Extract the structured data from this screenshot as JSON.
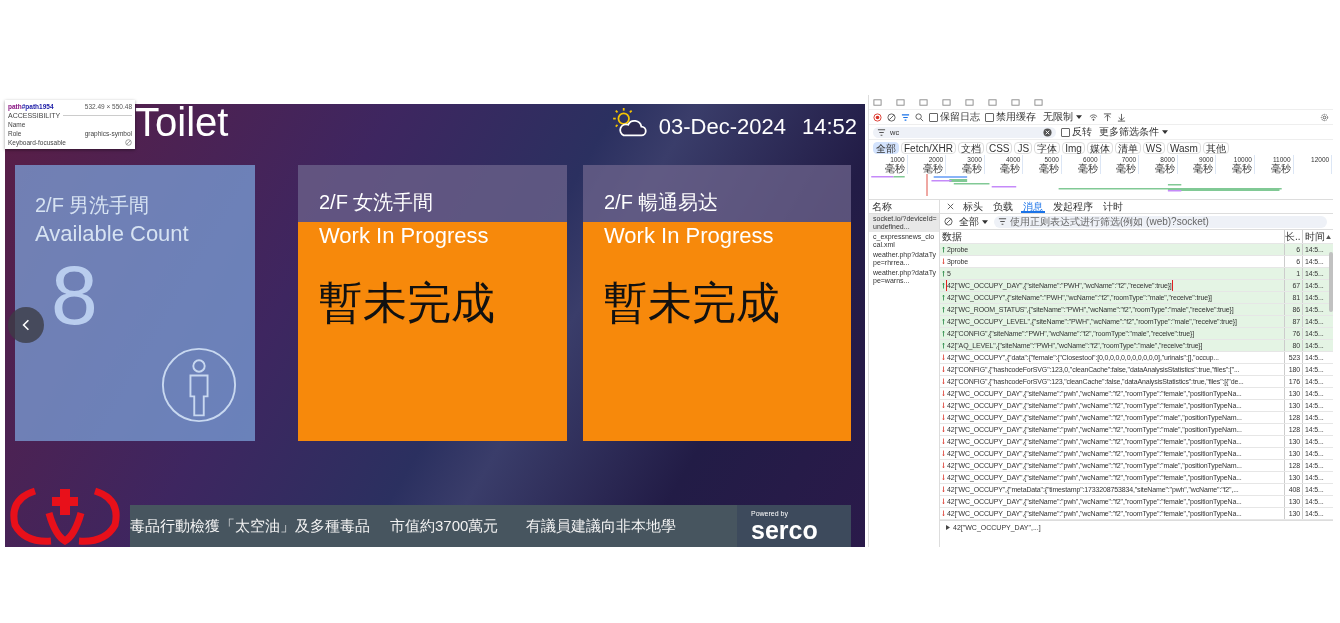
{
  "display": {
    "title": "Toilet",
    "date": "03-Dec-2024",
    "time": "14:52",
    "cards": [
      {
        "kind": "available",
        "title": "2/F 男洗手間",
        "subtitle": "Available Count",
        "value": "8"
      },
      {
        "kind": "wip",
        "title": "2/F 女洗手間",
        "subtitle": "Work In Progress",
        "value": "暫未完成"
      },
      {
        "kind": "wip",
        "title": "2/F 暢通易达",
        "subtitle": "Work In Progress",
        "value": "暫未完成"
      }
    ],
    "ticker": [
      "毒品行動檢獲「太空油」及多種毒品",
      "市值約3700萬元",
      "有議員建議向非本地學"
    ],
    "powered_by": "Powered by",
    "brand": "serco"
  },
  "inspector_tooltip": {
    "tag": "path",
    "id": "#path1954",
    "size": "532.49 × 550.48",
    "section": "ACCESSIBILITY",
    "name_label": "Name",
    "role_label": "Role",
    "role": "graphics-symbol",
    "focusable_label": "Keyboard-focusable",
    "focusable": false
  },
  "devtools": {
    "preserve_log": {
      "label": "保留日志",
      "checked": false
    },
    "disable_cache": {
      "label": "禁用缓存",
      "checked": false
    },
    "throttle": "无限制",
    "filter": {
      "value": "wc",
      "invert": {
        "label": "反转",
        "checked": false
      },
      "more": "更多筛选条件"
    },
    "types": [
      {
        "label": "全部",
        "selected": true
      },
      {
        "label": "Fetch/XHR",
        "selected": false
      },
      {
        "label": "文档",
        "selected": false
      },
      {
        "label": "CSS",
        "selected": false
      },
      {
        "label": "JS",
        "selected": false
      },
      {
        "label": "字体",
        "selected": false
      },
      {
        "label": "Img",
        "selected": false
      },
      {
        "label": "媒体",
        "selected": false
      },
      {
        "label": "清单",
        "selected": false
      },
      {
        "label": "WS",
        "selected": false
      },
      {
        "label": "Wasm",
        "selected": false
      },
      {
        "label": "其他",
        "selected": false
      }
    ],
    "timeline_ticks": [
      {
        "value": "1000",
        "unit": "毫秒"
      },
      {
        "value": "2000",
        "unit": "毫秒"
      },
      {
        "value": "3000",
        "unit": "毫秒"
      },
      {
        "value": "4000",
        "unit": "毫秒"
      },
      {
        "value": "5000",
        "unit": "毫秒"
      },
      {
        "value": "6000",
        "unit": "毫秒"
      },
      {
        "value": "7000",
        "unit": "毫秒"
      },
      {
        "value": "8000",
        "unit": "毫秒"
      },
      {
        "value": "9000",
        "unit": "毫秒"
      },
      {
        "value": "10000",
        "unit": "毫秒"
      },
      {
        "value": "11000",
        "unit": "毫秒"
      },
      {
        "value": "12000"
      }
    ],
    "requests_header": "名称",
    "requests": [
      {
        "name": "socket.io/?deviceId=undefined...",
        "selected": true
      },
      {
        "name": "c_expressnews_clocal.xml",
        "selected": false
      },
      {
        "name": "weather.php?dataType=rhrrea...",
        "selected": false
      },
      {
        "name": "weather.php?dataType=warns...",
        "selected": false
      }
    ],
    "detail_tabs": [
      {
        "label": "标头",
        "selected": false
      },
      {
        "label": "负载",
        "selected": false
      },
      {
        "label": "消息",
        "selected": true
      },
      {
        "label": "发起程序",
        "selected": false
      },
      {
        "label": "计时",
        "selected": false
      }
    ],
    "message_filter": {
      "type": "全部",
      "placeholder": "使用正则表达式进行筛选(例如 (web)?socket)"
    },
    "columns": [
      "数据",
      "长..",
      "时间"
    ],
    "messages": [
      {
        "kind": "sent",
        "data": "2probe",
        "length": "6",
        "time": "14:5...",
        "highlighted": false
      },
      {
        "kind": "received",
        "data": "3probe",
        "length": "6",
        "time": "14:5...",
        "highlighted": false
      },
      {
        "kind": "sent",
        "data": "5",
        "length": "1",
        "time": "14:5...",
        "highlighted": false
      },
      {
        "kind": "sent",
        "data": "42[\"WC_OCCUPY_DAY\",{\"siteName\":\"PWH\",\"wcName\":\"f2\",\"receive\":true}]",
        "length": "67",
        "time": "14:5...",
        "highlighted": true
      },
      {
        "kind": "sent",
        "data": "42[\"WC_OCCUPY\",{\"siteName\":\"PWH\",\"wcName\":\"f2\",\"roomType\":\"male\",\"receive\":true}]",
        "length": "81",
        "time": "14:5...",
        "highlighted": false
      },
      {
        "kind": "sent",
        "data": "42[\"WC_ROOM_STATUS\",{\"siteName\":\"PWH\",\"wcName\":\"f2\",\"roomType\":\"male\",\"receive\":true}]",
        "length": "86",
        "time": "14:5...",
        "highlighted": false
      },
      {
        "kind": "sent",
        "data": "42[\"WC_OCCUPY_LEVEL\",{\"siteName\":\"PWH\",\"wcName\":\"f2\",\"roomType\":\"male\",\"receive\":true}]",
        "length": "87",
        "time": "14:5...",
        "highlighted": false
      },
      {
        "kind": "sent",
        "data": "42[\"CONFIG\",{\"siteName\":\"PWH\",\"wcName\":\"f2\",\"roomType\":\"male\",\"receive\":true}]",
        "length": "76",
        "time": "14:5...",
        "highlighted": false
      },
      {
        "kind": "sent",
        "data": "42[\"AQ_LEVEL\",{\"siteName\":\"PWH\",\"wcName\":\"f2\",\"roomType\":\"male\",\"receive\":true}]",
        "length": "80",
        "time": "14:5...",
        "highlighted": false
      },
      {
        "kind": "received",
        "data": "42[\"WC_OCCUPY\",{\"data\":{\"female\":{\"Closestool\":[0,0,0,0,0,0,0,0,0,0,0],\"urinals\":[],\"occup...",
        "length": "523",
        "time": "14:5...",
        "highlighted": false
      },
      {
        "kind": "received",
        "data": "42[\"CONFIG\",{\"hashcodeForSVG\":123,0,\"cleanCache\":false,\"dataAnalysisStatistics\":true,\"files\":[\"...",
        "length": "180",
        "time": "14:5...",
        "highlighted": false
      },
      {
        "kind": "received",
        "data": "42[\"CONFIG\",{\"hashcodeForSVG\":123,\"cleanCache\":false,\"dataAnalysisStatistics\":true,\"files\":[{\"de...",
        "length": "176",
        "time": "14:5...",
        "highlighted": false
      },
      {
        "kind": "received",
        "data": "42[\"WC_OCCUPY_DAY\",{\"siteName\":\"pwh\",\"wcName\":\"f2\",\"roomType\":\"female\",\"positionTypeNa...",
        "length": "130",
        "time": "14:5...",
        "highlighted": false
      },
      {
        "kind": "received",
        "data": "42[\"WC_OCCUPY_DAY\",{\"siteName\":\"pwh\",\"wcName\":\"f2\",\"roomType\":\"female\",\"positionTypeNa...",
        "length": "130",
        "time": "14:5...",
        "highlighted": false
      },
      {
        "kind": "received",
        "data": "42[\"WC_OCCUPY_DAY\",{\"siteName\":\"pwh\",\"wcName\":\"f2\",\"roomType\":\"male\",\"positionTypeNam...",
        "length": "128",
        "time": "14:5...",
        "highlighted": false
      },
      {
        "kind": "received",
        "data": "42[\"WC_OCCUPY_DAY\",{\"siteName\":\"pwh\",\"wcName\":\"f2\",\"roomType\":\"male\",\"positionTypeNam...",
        "length": "128",
        "time": "14:5...",
        "highlighted": false
      },
      {
        "kind": "received",
        "data": "42[\"WC_OCCUPY_DAY\",{\"siteName\":\"pwh\",\"wcName\":\"f2\",\"roomType\":\"female\",\"positionTypeNa...",
        "length": "130",
        "time": "14:5...",
        "highlighted": false
      },
      {
        "kind": "received",
        "data": "42[\"WC_OCCUPY_DAY\",{\"siteName\":\"pwh\",\"wcName\":\"f2\",\"roomType\":\"female\",\"positionTypeNa...",
        "length": "130",
        "time": "14:5...",
        "highlighted": false
      },
      {
        "kind": "received",
        "data": "42[\"WC_OCCUPY_DAY\",{\"siteName\":\"pwh\",\"wcName\":\"f2\",\"roomType\":\"male\",\"positionTypeNam...",
        "length": "128",
        "time": "14:5...",
        "highlighted": false
      },
      {
        "kind": "received",
        "data": "42[\"WC_OCCUPY_DAY\",{\"siteName\":\"pwh\",\"wcName\":\"f2\",\"roomType\":\"female\",\"positionTypeNa...",
        "length": "130",
        "time": "14:5...",
        "highlighted": false
      },
      {
        "kind": "received",
        "data": "42[\"WC_OCCUPY\",{\"metaData\":{\"timestamp\":1733208753834,\"siteName\":\"pwh\",\"wcName\":\"f2\",...",
        "length": "408",
        "time": "14:5...",
        "highlighted": false
      },
      {
        "kind": "received",
        "data": "42[\"WC_OCCUPY_DAY\",{\"siteName\":\"pwh\",\"wcName\":\"f2\",\"roomType\":\"female\",\"positionTypeNa...",
        "length": "130",
        "time": "14:5...",
        "highlighted": false
      },
      {
        "kind": "received",
        "data": "42[\"WC_OCCUPY_DAY\",{\"siteName\":\"pwh\",\"wcName\":\"f2\",\"roomType\":\"female\",\"positionTypeNa...",
        "length": "130",
        "time": "14:5...",
        "highlighted": false
      }
    ],
    "preview": "42[\"WC_OCCUPY_DAY\",...]"
  }
}
